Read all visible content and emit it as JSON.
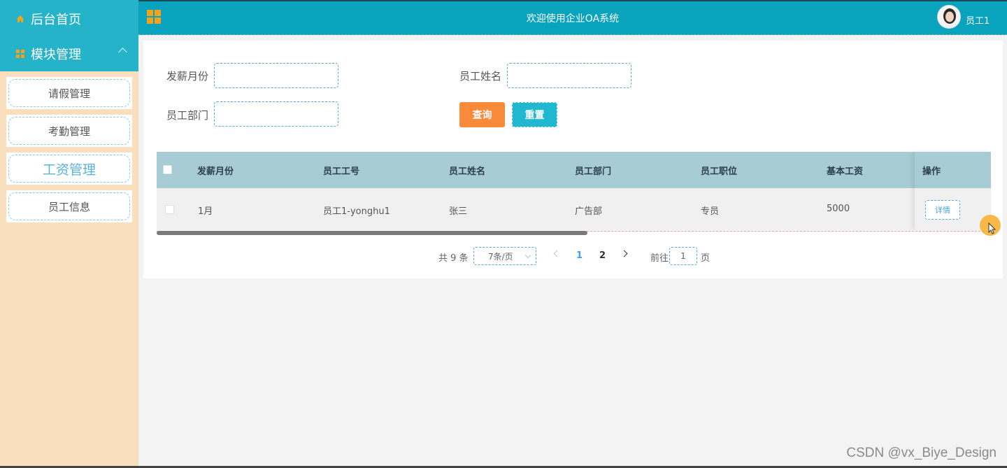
{
  "sidebar": {
    "home_label": "后台首页",
    "module_label": "模块管理",
    "menu": [
      {
        "label": "请假管理"
      },
      {
        "label": "考勤管理"
      },
      {
        "label": "工资管理"
      },
      {
        "label": "员工信息"
      }
    ],
    "active_item": "工资管理"
  },
  "topbar": {
    "title": "欢迎使用企业OA系统",
    "username": "员工1"
  },
  "filters": {
    "month_label": "发薪月份",
    "name_label": "员工姓名",
    "dept_label": "员工部门",
    "month_value": "",
    "name_value": "",
    "dept_value": "",
    "search_button": "查询",
    "reset_button": "重置"
  },
  "table": {
    "columns": [
      "发薪月份",
      "员工工号",
      "员工姓名",
      "员工部门",
      "员工职位",
      "基本工资",
      "操作"
    ],
    "rows": [
      {
        "month": "1月",
        "emp_id": "员工1-yonghu1",
        "name": "张三",
        "dept": "广告部",
        "position": "专员",
        "salary": "5000",
        "action": "详情"
      }
    ]
  },
  "pagination": {
    "total_text": "共 9 条",
    "page_size": "7条/页",
    "pages": [
      "1",
      "2"
    ],
    "current_page": "1",
    "goto_prefix": "前往",
    "goto_value": "1",
    "goto_suffix": "页"
  },
  "watermark": "CSDN @vx_Biye_Design",
  "colors": {
    "sidebar_bg": "#f9dfbd",
    "header_teal": "#0aa3be",
    "accent_orange": "#f98a3a",
    "accent_cyan": "#20b8d0",
    "icon_orange": "#f7a21b",
    "table_header": "#a8ccd3"
  }
}
